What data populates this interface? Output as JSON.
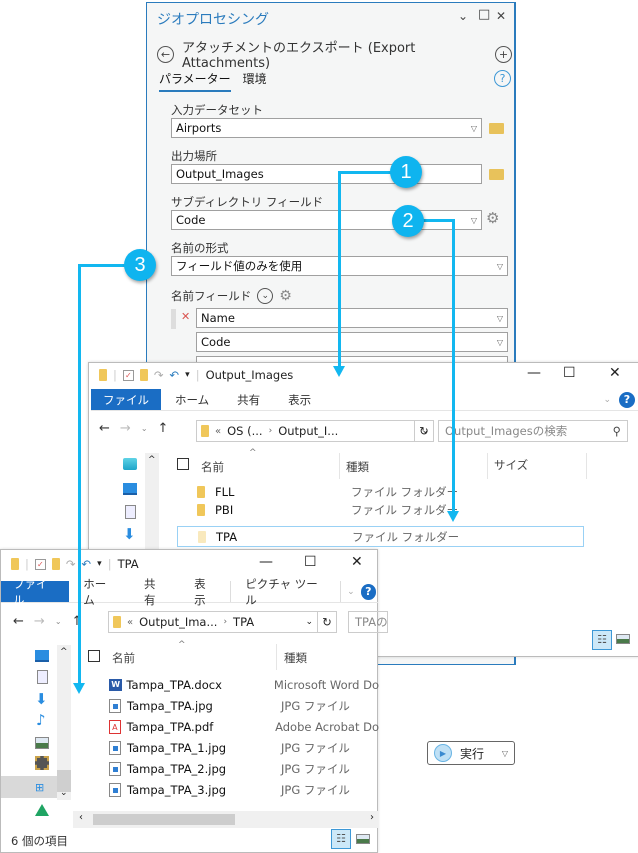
{
  "geoprocessing": {
    "title": "ジオプロセシング",
    "window_buttons": {
      "collapse": "⌄",
      "maximize": "□",
      "close": "✕"
    },
    "tool_title": "アタッチメントのエクスポート (Export Attachments)",
    "tabs": [
      {
        "label": "パラメーター",
        "active": true
      },
      {
        "label": "環境",
        "active": false
      }
    ],
    "help": "?",
    "params": {
      "input_dataset": {
        "label": "入力データセット",
        "value": "Airports"
      },
      "output_location": {
        "label": "出力場所",
        "value": "Output_Images"
      },
      "subdirectory_field": {
        "label": "サブディレクトリ フィールド",
        "value": "Code"
      },
      "name_format": {
        "label": "名前の形式",
        "value": "フィールド値のみを使用"
      },
      "name_fields": {
        "label": "名前フィールド",
        "values": [
          "Name",
          "Code"
        ]
      }
    },
    "run_button": "実行"
  },
  "explorer1": {
    "title": "Output_Images",
    "ribbon": {
      "file": "ファイル",
      "tabs": [
        "ホーム",
        "共有",
        "表示"
      ]
    },
    "address": {
      "prefix": "«",
      "parts": [
        "OS (...",
        "Output_I..."
      ]
    },
    "search_placeholder": "Output_Imagesの検索",
    "columns": {
      "name": "名前",
      "type": "種類",
      "size": "サイズ"
    },
    "rows": [
      {
        "name": "FLL",
        "type": "ファイル フォルダー"
      },
      {
        "name": "PBI",
        "type": "ファイル フォルダー"
      },
      {
        "name": "TPA",
        "type": "ファイル フォルダー",
        "selected": true
      }
    ]
  },
  "explorer2": {
    "title": "TPA",
    "ribbon": {
      "file": "ファイル",
      "tabs": [
        "ホーム",
        "共有",
        "表示",
        "ピクチャ ツール"
      ]
    },
    "address": {
      "prefix": "«",
      "parts": [
        "Output_Ima...",
        "TPA"
      ]
    },
    "search_placeholder": "TPAの検索",
    "columns": {
      "name": "名前",
      "type": "種類"
    },
    "rows": [
      {
        "name": "Tampa_TPA.docx",
        "type": "Microsoft Word Do",
        "icon": "word"
      },
      {
        "name": "Tampa_TPA.jpg",
        "type": "JPG ファイル",
        "icon": "jpg"
      },
      {
        "name": "Tampa_TPA.pdf",
        "type": "Adobe Acrobat Do",
        "icon": "pdf"
      },
      {
        "name": "Tampa_TPA_1.jpg",
        "type": "JPG ファイル",
        "icon": "jpg"
      },
      {
        "name": "Tampa_TPA_2.jpg",
        "type": "JPG ファイル",
        "icon": "jpg"
      },
      {
        "name": "Tampa_TPA_3.jpg",
        "type": "JPG ファイル",
        "icon": "jpg"
      }
    ],
    "status": "6 個の項目"
  },
  "callouts": [
    "1",
    "2",
    "3"
  ],
  "colors": {
    "accent": "#2a7bbd",
    "callout": "#12b7f0",
    "file_tab": "#1a6dc4"
  }
}
